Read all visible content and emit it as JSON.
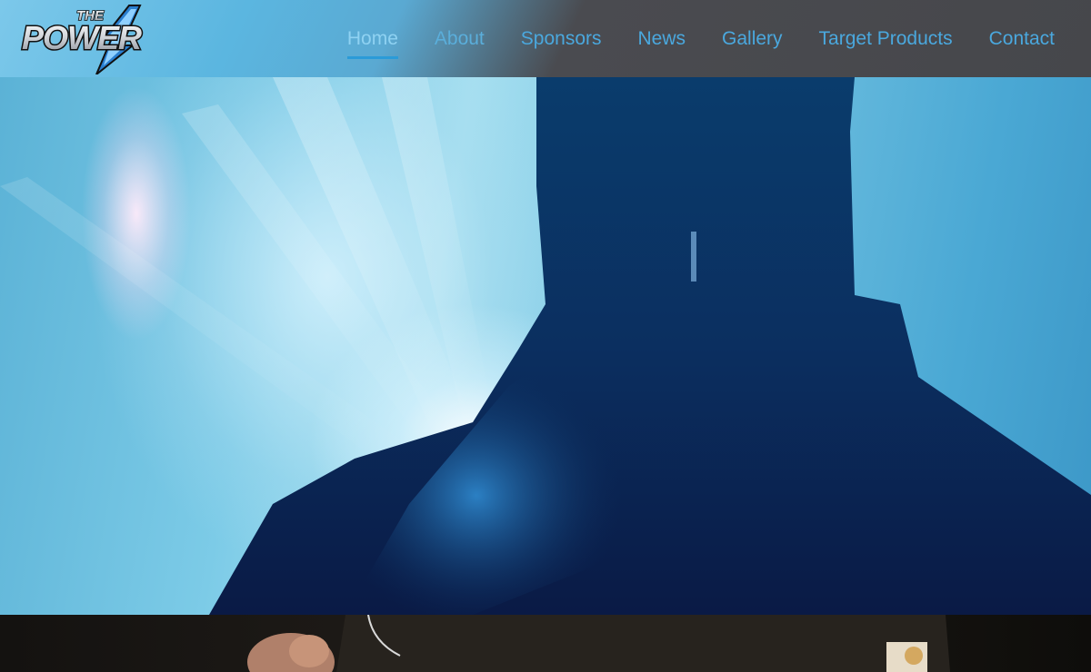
{
  "brand": {
    "logo_text_top": "THE",
    "logo_text_main": "POWER"
  },
  "nav": {
    "items": [
      {
        "label": "Home",
        "active": true
      },
      {
        "label": "About",
        "active": false
      },
      {
        "label": "Sponsors",
        "active": false
      },
      {
        "label": "News",
        "active": false
      },
      {
        "label": "Gallery",
        "active": false
      },
      {
        "label": "Target Products",
        "active": false
      },
      {
        "label": "Contact",
        "active": false
      }
    ]
  },
  "colors": {
    "nav_text": "#4aa8de",
    "nav_active_underline": "#2b9bd8",
    "header_dark": "#46474b",
    "header_light": "#7cc8ea"
  },
  "hero": {
    "media": "video-still"
  }
}
